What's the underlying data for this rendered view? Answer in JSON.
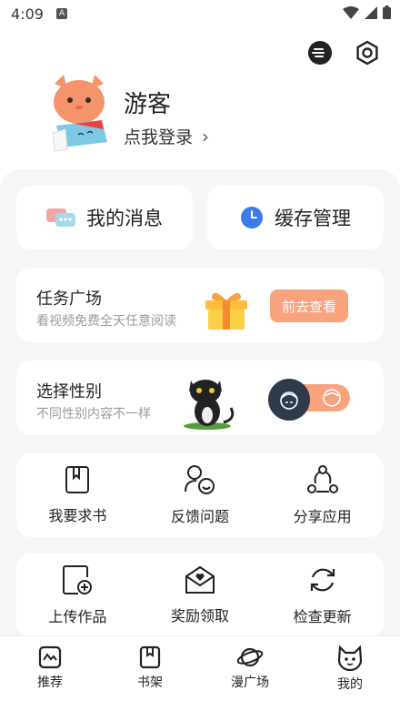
{
  "status_bar": {
    "time": "4:09",
    "notif_icon": "A"
  },
  "top_icons": [
    "theme-toggle-icon",
    "settings-icon"
  ],
  "profile": {
    "username": "游客",
    "login_label": "点我登录",
    "chevron": "›"
  },
  "cards": {
    "messages_label": "我的消息",
    "cache_label": "缓存管理"
  },
  "task": {
    "title": "任务广场",
    "subtitle": "看视频免费全天任意阅读",
    "button": "前去查看"
  },
  "gender": {
    "title": "选择性别",
    "subtitle": "不同性别内容不一样"
  },
  "grid1": [
    {
      "label": "我要求书",
      "icon": "book-icon"
    },
    {
      "label": "反馈问题",
      "icon": "feedback-icon"
    },
    {
      "label": "分享应用",
      "icon": "share-icon"
    }
  ],
  "grid2": [
    {
      "label": "上传作品",
      "icon": "upload-icon"
    },
    {
      "label": "奖励领取",
      "icon": "reward-icon"
    },
    {
      "label": "检查更新",
      "icon": "refresh-icon"
    }
  ],
  "tabs": [
    {
      "label": "推荐",
      "icon": "recommend-icon"
    },
    {
      "label": "书架",
      "icon": "bookshelf-icon"
    },
    {
      "label": "漫广场",
      "icon": "planet-icon"
    },
    {
      "label": "我的",
      "icon": "cat-face-icon"
    }
  ],
  "colors": {
    "accent": "#f8a27e",
    "knob": "#2f3b4a",
    "clock_blue": "#3d7be8"
  }
}
